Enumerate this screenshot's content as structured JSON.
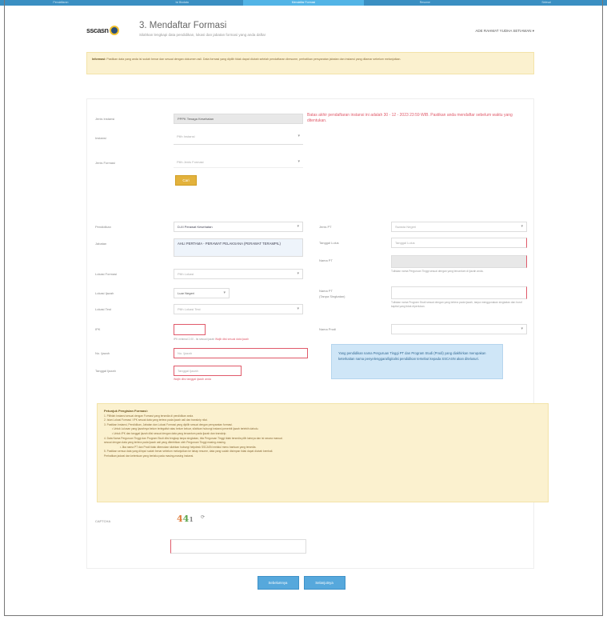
{
  "steps": [
    "Pendaftaran",
    "Isi Biodata",
    "Mendaftar Formasi",
    "Resume",
    "Selesai"
  ],
  "active_step": 2,
  "header": {
    "logo_text": "sscasn",
    "title": "3. Mendaftar Formasi",
    "subtitle": "Silahkan lengkapi data pendidikan, lokasi dan jabatan formasi yang anda daftar",
    "user_menu": "ADE RAHMAT YUDHA SETIAWAN ▾"
  },
  "alert": {
    "bold": "Informasi:",
    "text": "Pastikan data yang anda isi sudah benar dan sesuai dengan dokumen asli. Data formasi yang dipilih tidak dapat diubah setelah pendaftaran diresume, perhatikan persyaratan jabatan dan instansi yang dilamar sebelum melanjutkan."
  },
  "instansi": {
    "jenis_label": "Jenis Instansi",
    "jenis_value": "PPPK Tenaga Kesehatan",
    "instansi_label": "Instansi",
    "instansi_placeholder": "Pilih Instansi",
    "jenis_formasi_label": "Jenis Formasi",
    "jenis_formasi_placeholder": "Pilih Jenis Formasi",
    "cari_label": "Cari",
    "warning": "Batas akhir pendaftaran instansi ini adalah 30 - 12 - 2023 23:59 WIB. Pastikan anda mendaftar sebelum waktu yang ditentukan."
  },
  "form_left": {
    "pendidikan_label": "Pendidikan",
    "pendidikan_value": "D-III Perawat Kesehatan",
    "jabatan_label": "Jabatan",
    "jabatan_value": "AHLI PERTAMA - PERAWAT PELAKSANA (PERAWAT TERAMPIL)",
    "lokasi_label": "Lokasi Formasi",
    "lokasi_value": "Pilih Lokasi",
    "ijazah_label": "Lokasi Ijazah",
    "ijazah_value": "Luar Negeri",
    "tahun_label": "Lokasi Test",
    "tahun_value": "Pilih Lokasi Test",
    "ipk_label": "IPK",
    "ipk_value": "",
    "ipk_help": "IPK minimal 2.00 - Isi sesuai ijazah",
    "ipk_help_red": "Wajib diisi sesuai data ijazah",
    "noijazah_label": "No. Ijazah",
    "noijazah_placeholder": "No. Ijazah",
    "tgl_label": "Tanggal Ijazah",
    "tgl_placeholder": "Tanggal Ijazah",
    "tgl_error": "Wajib diisi tanggal ijazah anda"
  },
  "form_right": {
    "jenis_pt_label": "Jenis PT",
    "jenis_pt_value": "Swasta Negeri",
    "tgl_lulus_label": "Tanggal Lulus",
    "tgl_lulus_placeholder": "Tanggal Lulus",
    "nama_pt_label": "Nama PT",
    "nama_pt_help": "Tuliskan nama Perguruan Tinggi sesuai dengan yang tercantum di ijazah anda.",
    "prodi_label": "Nama PT",
    "prodi_label2": "(Tanpa Singkatan)",
    "prodi_help": "Tuliskan nama Program Studi sesuai dengan yang tertera pada ijazah, tanpa menggunakan singkatan dan huruf kapital yang tidak diperlukan.",
    "akreditasi_label": "Nama Prodi",
    "info": "Yang pendidikan nama Perguruan Tinggi PT dan Program Studi (Prodi) yang diakhirkan merupakan keterkaitan nama penyelenggara/ligitalisi pendidikan tersebut kepada SSCASN akan ditelusuri."
  },
  "notes": {
    "title": "Petunjuk Pengisian Formasi:",
    "items": [
      "1. Pilihlah Instansi sesuai dengan Formasi yang tersedia di pendidikan anda.",
      "2. Isian Lokasi Formasi / IPK sesuai data yang tertera pada ijazah asli dan transkrip nilai.",
      "3. Pastikan Instansi, Pendidikan, Jabatan dan Lokasi Formasi yang dipilih sesuai dengan persyaratan formasi.",
      "   • Untuk Lulusan yang ijazahnya belum terlegalisir atau belum keluar, silahkan hubungi instansi penerbit ijazah terlebih dahulu.",
      "   • Untuk IPK dan tanggal ijazah diisi sesuai dengan data yang tercantum pada ijazah dan transkrip.",
      "4. Data Nama Perguruan Tinggi dan Program Studi diisi lengkap tanpa singkatan, bila Perguruan Tinggi tidak tersedia pilih lainnya dan isi secara manual.",
      "   sesuai dengan data yang tertera pada ijazah asli yang diterbitkan oleh Perguruan Tinggi masing-masing.",
      "      • Jika nama PT dan Prodi tidak ditemukan silahkan hubungi helpdesk SSCASN melalui menu bantuan yang tersedia.",
      "5. Pastikan semua data yang diinput sudah benar sebelum melanjutkan ke tahap resume, data yang sudah disimpan tidak dapat diubah kembali.",
      "   Perhatikan jadwal dan ketentuan yang berlaku pada masing-masing instansi."
    ]
  },
  "captcha": {
    "label": "CAPTCHA",
    "chars": [
      "4",
      "4",
      "1"
    ],
    "refresh": "⟳"
  },
  "buttons": {
    "back": "Sebelumnya",
    "next": "Selanjutnya"
  },
  "colors": {
    "topbar": "#3a8fc2",
    "active_step": "#52b4e6",
    "accent": "#56a8dc",
    "warning_bg": "#fbf1cf",
    "error": "#e05a6a",
    "cari": "#e3b23c"
  }
}
